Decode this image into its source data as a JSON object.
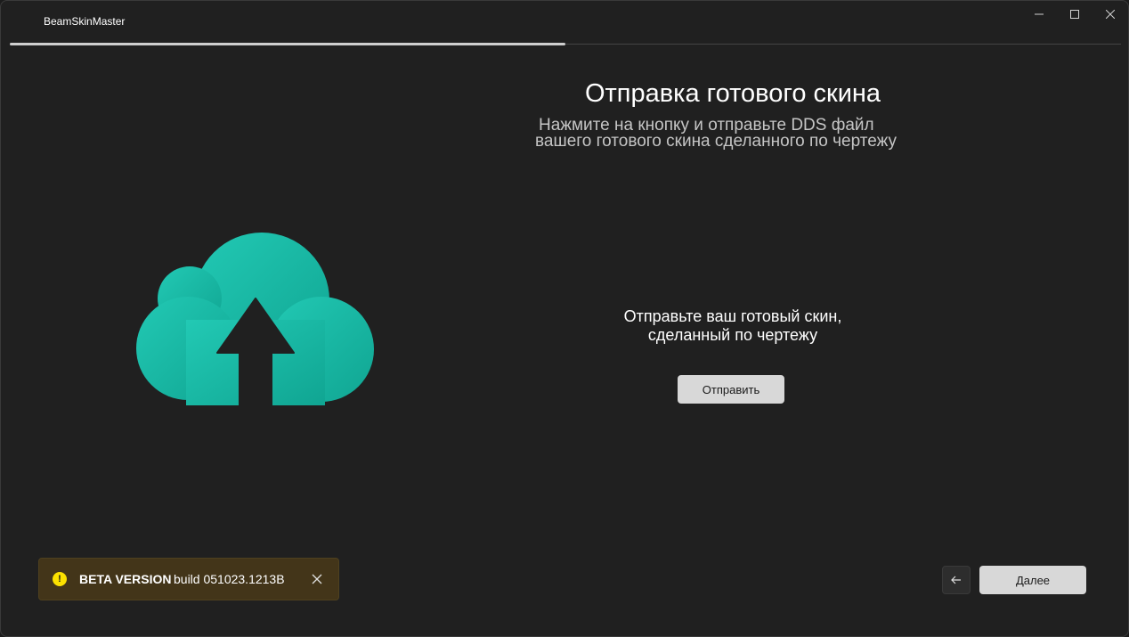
{
  "window": {
    "title": "BeamSkinMaster",
    "controls": [
      "minimize-icon",
      "maximize-icon",
      "close-icon"
    ]
  },
  "progress": {
    "value": 0.5
  },
  "page": {
    "heading": "Отправка готового скина",
    "subheading_line1": "Нажмите на кнопку и отправьте DDS файл",
    "subheading_line2": "вашего готового скина сделанного по чертежу"
  },
  "illustration": {
    "icon": "cloud-upload-icon",
    "color": "#1abfa6"
  },
  "upload": {
    "prompt_line1": "Отправьте ваш готовый скин,",
    "prompt_line2": "сделанный по чертежу",
    "button_label": "Отправить"
  },
  "infobar": {
    "icon": "warning-icon",
    "title": "BETA VERSION",
    "message": "build 051023.1213B",
    "background": "#433519"
  },
  "navigation": {
    "back_icon": "arrow-left-icon",
    "next_label": "Далее"
  }
}
